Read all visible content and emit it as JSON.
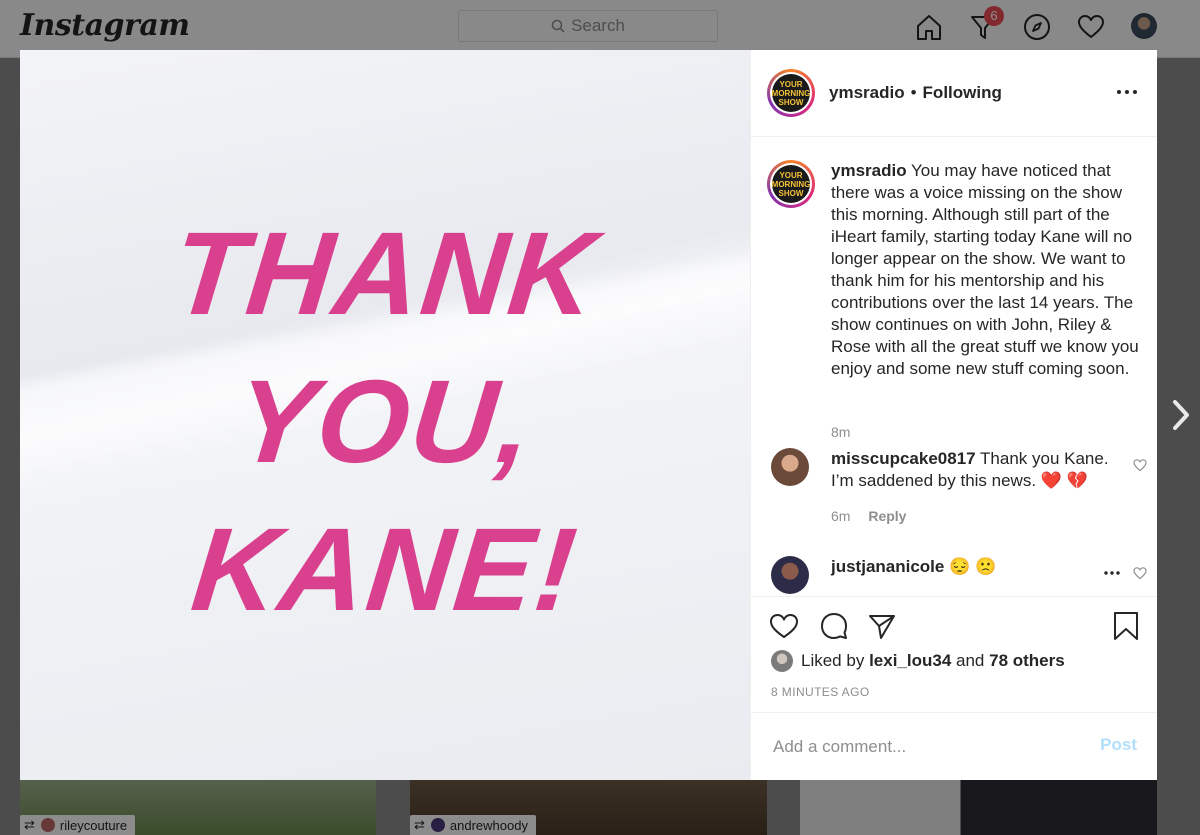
{
  "nav": {
    "logo": "Instagram",
    "search_placeholder": "Search",
    "activity_badge": "6",
    "icons": [
      "home-icon",
      "direct-icon",
      "explore-icon",
      "heart-icon",
      "profile-avatar"
    ]
  },
  "feed": {
    "tiles": [
      {
        "user": "rileycouture"
      },
      {
        "user": "andrewhoody"
      },
      {
        "user": ""
      }
    ]
  },
  "post": {
    "image_text": [
      "THANK",
      "YOU,",
      "KANE!"
    ],
    "image_text_color": "#d9418f",
    "header": {
      "username": "ymsradio",
      "separator": "•",
      "follow_status": "Following"
    },
    "caption": {
      "username": "ymsradio",
      "text": "You may have noticed that there was a voice missing on the show this morning. Although still part of the iHeart family, starting today Kane will no longer appear on the show. We want to thank him for his mentorship and his contributions over the last 14 years. The show continues on with John, Riley & Rose with all the great stuff we know you enjoy and some new stuff coming soon.",
      "time": "8m"
    },
    "comments": [
      {
        "username": "misscupcake0817",
        "text": "Thank you Kane. I’m saddened by this news. ❤️ 💔",
        "time": "6m",
        "reply": "Reply"
      },
      {
        "username": "justjananicole",
        "text": "😔 🙁"
      }
    ],
    "likes": {
      "prefix": "Liked by",
      "liked_user": "lexi_lou34",
      "and": "and",
      "others": "78 others"
    },
    "timestamp": "8 MINUTES AGO",
    "add_comment_placeholder": "Add a comment...",
    "post_button": "Post"
  },
  "avatar_text": "YOUR MORNING SHOW",
  "colors": {
    "accent_link": "#b2dffc",
    "badge": "#ed4956",
    "text": "#262626",
    "muted": "#8e8e8e"
  }
}
